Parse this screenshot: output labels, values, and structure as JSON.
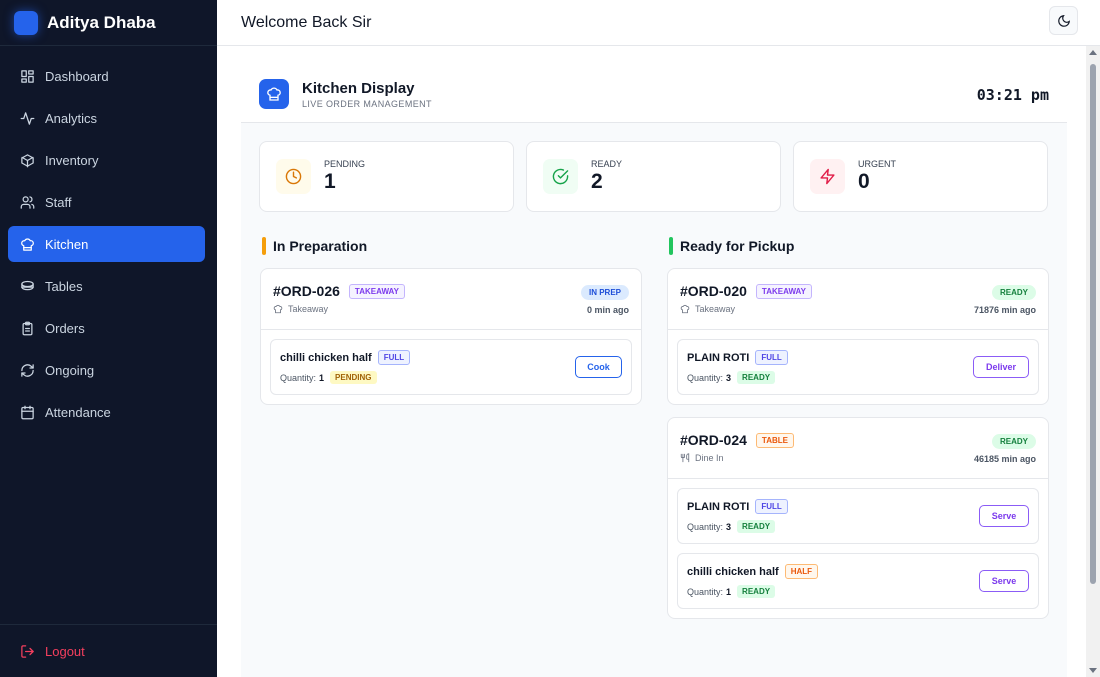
{
  "sidebar": {
    "brand": "Aditya Dhaba",
    "items": [
      {
        "label": "Dashboard"
      },
      {
        "label": "Analytics"
      },
      {
        "label": "Inventory"
      },
      {
        "label": "Staff"
      },
      {
        "label": "Kitchen",
        "active": true
      },
      {
        "label": "Tables"
      },
      {
        "label": "Orders"
      },
      {
        "label": "Ongoing"
      },
      {
        "label": "Attendance"
      }
    ],
    "logout": "Logout"
  },
  "header": {
    "welcome": "Welcome Back Sir",
    "theme_icon": "moon-icon"
  },
  "kitchen": {
    "title": "Kitchen Display",
    "subtitle": "LIVE ORDER MANAGEMENT",
    "time": "03:21 pm"
  },
  "stats": {
    "pending": {
      "label": "PENDING",
      "value": "1"
    },
    "ready": {
      "label": "READY",
      "value": "2"
    },
    "urgent": {
      "label": "URGENT",
      "value": "0"
    }
  },
  "columns": {
    "preparation": {
      "title": "In Preparation",
      "orders": [
        {
          "id": "#ORD-026",
          "tag": "TAKEAWAY",
          "type": "Takeaway",
          "status": "IN PREP",
          "elapsed": "0 min ago",
          "items": [
            {
              "name": "chilli chicken half",
              "portion": "FULL",
              "qty_label": "Quantity:",
              "qty": "1",
              "status": "PENDING",
              "action": "Cook"
            }
          ]
        }
      ]
    },
    "pickup": {
      "title": "Ready for Pickup",
      "orders": [
        {
          "id": "#ORD-020",
          "tag": "TAKEAWAY",
          "type": "Takeaway",
          "status": "READY",
          "elapsed": "71876 min ago",
          "items": [
            {
              "name": "PLAIN ROTI",
              "portion": "FULL",
              "qty_label": "Quantity:",
              "qty": "3",
              "status": "READY",
              "action": "Deliver"
            }
          ]
        },
        {
          "id": "#ORD-024",
          "tag": "TABLE",
          "type": "Dine In",
          "status": "READY",
          "elapsed": "46185 min ago",
          "items": [
            {
              "name": "PLAIN ROTI",
              "portion": "FULL",
              "qty_label": "Quantity:",
              "qty": "3",
              "status": "READY",
              "action": "Serve"
            },
            {
              "name": "chilli chicken half",
              "portion": "HALF",
              "qty_label": "Quantity:",
              "qty": "1",
              "status": "READY",
              "action": "Serve"
            }
          ]
        }
      ]
    }
  },
  "colors": {
    "sidebar_bg": "#0f1629",
    "accent": "#2563eb",
    "preparation_bar": "#f59e0b",
    "pickup_bar": "#22c55e",
    "logout": "#f43f5e"
  }
}
